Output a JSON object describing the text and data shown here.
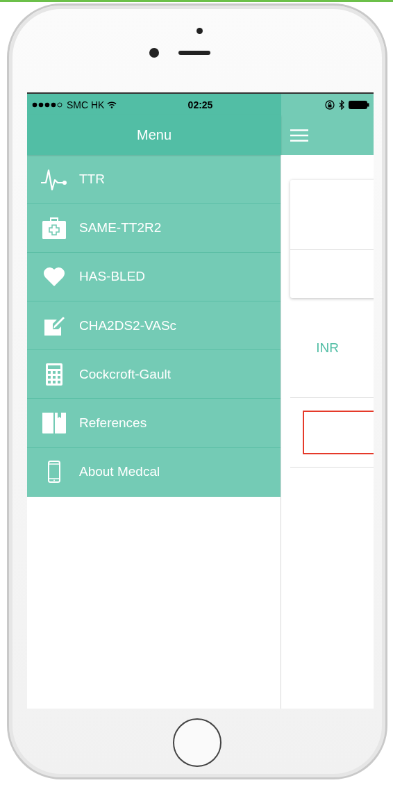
{
  "status_bar": {
    "carrier": "SMC HK",
    "time": "02:25"
  },
  "menu": {
    "title": "Menu",
    "items": [
      {
        "label": "TTR",
        "kind": "pulse"
      },
      {
        "label": "SAME-TT2R2",
        "kind": "kit"
      },
      {
        "label": "HAS-BLED",
        "kind": "heart"
      },
      {
        "label": "CHA2DS2-VASc",
        "kind": "edit"
      },
      {
        "label": "Cockcroft-Gault",
        "kind": "calculator"
      },
      {
        "label": "References",
        "kind": "book"
      },
      {
        "label": "About Medcal",
        "kind": "phone"
      }
    ]
  },
  "main": {
    "field_label": "INR",
    "field_invalid": true
  }
}
